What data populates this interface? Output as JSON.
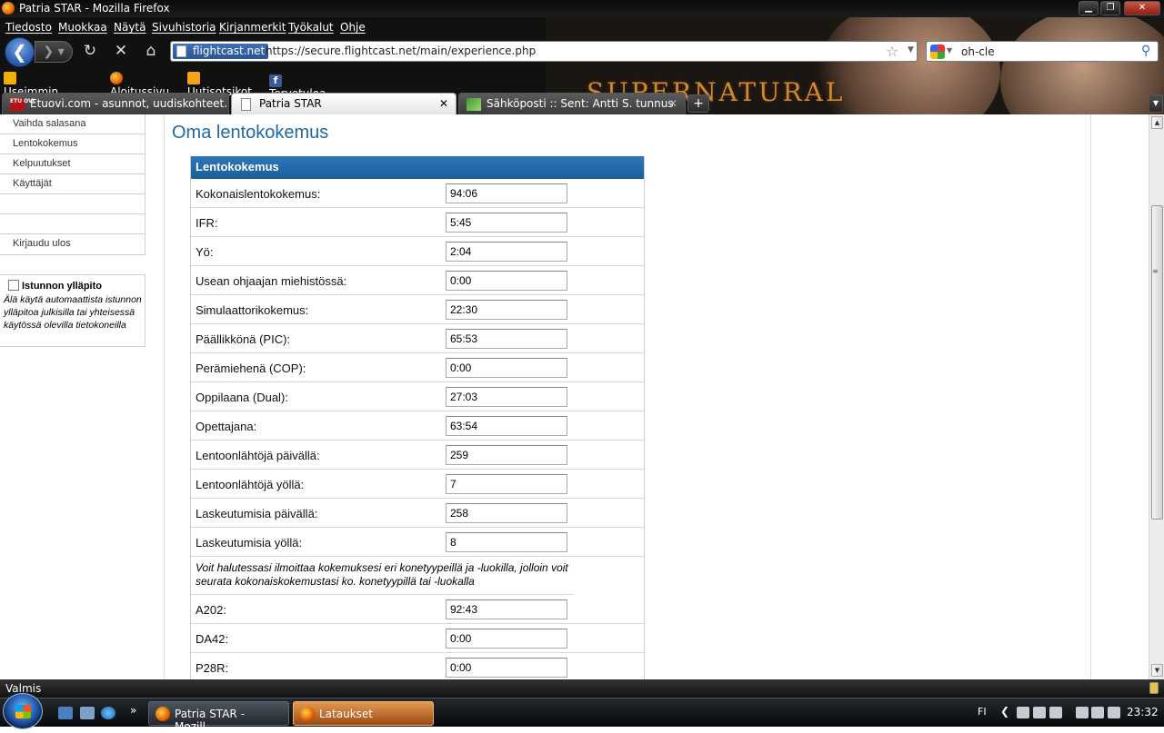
{
  "window": {
    "title": "Patria STAR - Mozilla Firefox"
  },
  "menu": [
    "Tiedosto",
    "Muokkaa",
    "Näytä",
    "Sivuhistoria",
    "Kirjanmerkit",
    "Työkalut",
    "Ohje"
  ],
  "navbar": {
    "site_identity": "flightcast.net",
    "url": "https://secure.flightcast.net/main/experience.php",
    "search_text": "oh-cle"
  },
  "bookmarks": [
    "Useimmin avatut",
    "Aloitussivu",
    "Uutisotsikot",
    "Tervetuloa Facebookiin"
  ],
  "theme_logo": "SUPERNATURAL",
  "tabs": [
    {
      "label": "Etuovi.com - asunnot, uudiskohteet...",
      "icon_text": "ETU OVI"
    },
    {
      "label": "Patria STAR"
    },
    {
      "label": "Sähköposti :: Sent: Antti S. tunnus"
    }
  ],
  "sidenav": [
    "Vaihda salasana",
    "Lentokokemus",
    "Kelpuutukset",
    "Käyttäjät",
    "",
    "",
    "Kirjaudu ulos"
  ],
  "session": {
    "title": "Istunnon ylläpito",
    "description": "Älä käytä automaattista istunnon ylläpitoa julkisilla tai yhteisessä käytössä olevilla tietokoneilla"
  },
  "page": {
    "title": "Oma lentokokemus",
    "panel_header": "Lentokokemus",
    "rows": [
      {
        "label": "Kokonaislentokokemus:",
        "value": "94:06"
      },
      {
        "label": "IFR:",
        "value": "5:45"
      },
      {
        "label": "Yö:",
        "value": "2:04"
      },
      {
        "label": "Usean ohjaajan miehistössä:",
        "value": "0:00"
      },
      {
        "label": "Simulaattorikokemus:",
        "value": "22:30"
      },
      {
        "label": "Päällikkönä (PIC):",
        "value": "65:53"
      },
      {
        "label": "Perämiehenä (COP):",
        "value": "0:00"
      },
      {
        "label": "Oppilaana (Dual):",
        "value": "27:03"
      },
      {
        "label": "Opettajana:",
        "value": "63:54"
      },
      {
        "label": "Lentoonlähtöjä päivällä:",
        "value": "259"
      },
      {
        "label": "Lentoonlähtöjä yöllä:",
        "value": "7"
      },
      {
        "label": "Laskeutumisia päivällä:",
        "value": "258"
      },
      {
        "label": "Laskeutumisia yöllä:",
        "value": "8"
      }
    ],
    "note": "Voit halutessasi ilmoittaa kokemuksesi eri konetyypeillä ja -luokilla, jolloin voit seurata kokonaiskokemustasi ko. konetyypillä tai -luokalla",
    "type_rows": [
      {
        "label": "A202:",
        "value": "92:43"
      },
      {
        "label": "DA42:",
        "value": "0:00"
      },
      {
        "label": "P28R:",
        "value": "0:00"
      }
    ]
  },
  "status": {
    "text": "Valmis"
  },
  "taskbar": {
    "tasks": [
      "Patria STAR - Mozill...",
      "Lataukset"
    ],
    "language": "FI",
    "clock": "23:32"
  }
}
